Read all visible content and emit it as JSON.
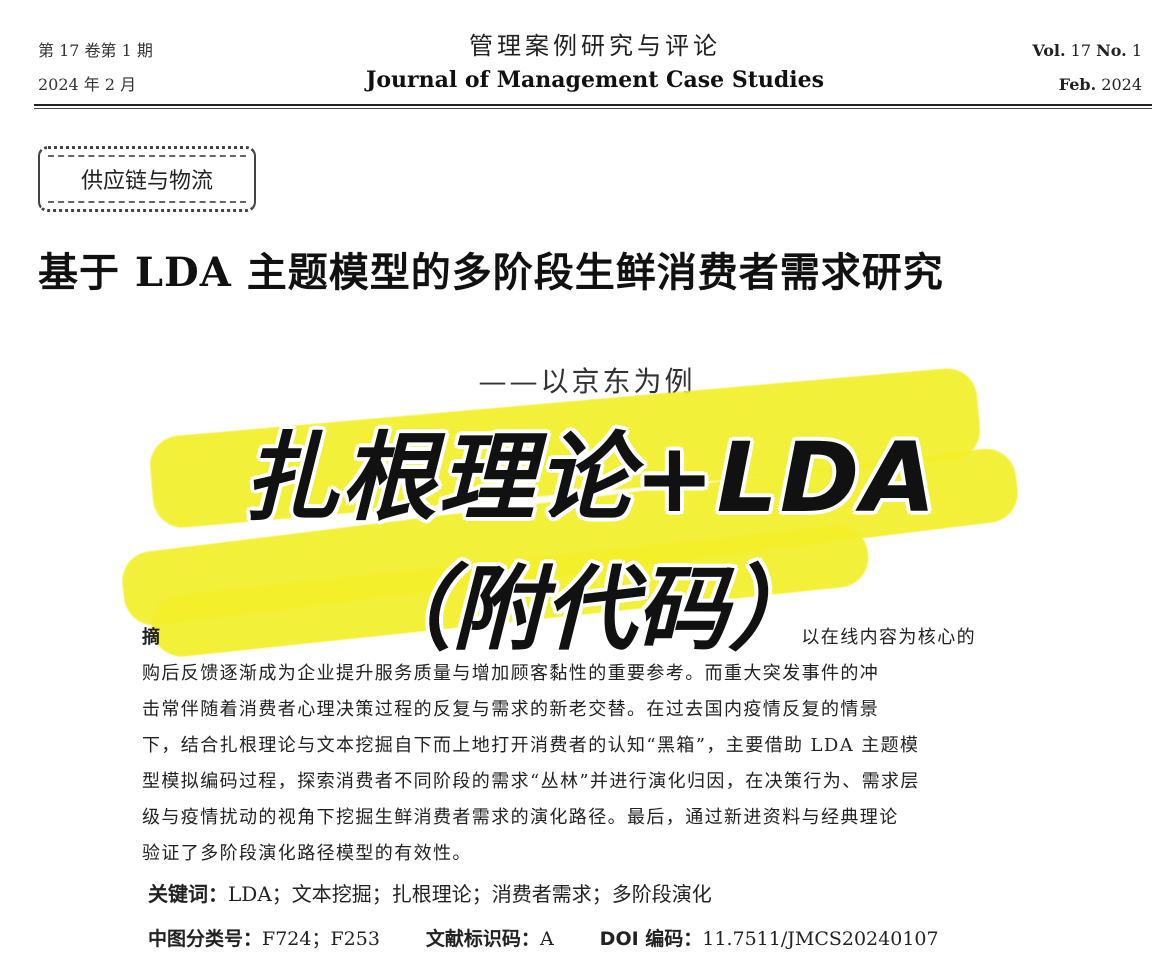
{
  "header": {
    "issue_cn": "第 17 卷第 1 期",
    "date_cn": "2024 年 2 月",
    "journal_cn": "管理案例研究与评论",
    "journal_en": "Journal of Management Case Studies",
    "vol_label": "Vol.",
    "vol_text": "17",
    "no_label": "No.",
    "no_text": "1",
    "month_label": "Feb.",
    "year_text": "2024"
  },
  "column_badge": "供应链与物流",
  "title": "基于 LDA 主题模型的多阶段生鲜消费者需求研究",
  "subtitle": "——以京东为例",
  "overlay": {
    "line1": "扎根理论+LDA",
    "line2": "（附代码）"
  },
  "highlight_color": "#f3ef2a",
  "abstract": {
    "label": "摘",
    "lines": [
      "以在线内容为核心的",
      "购后反馈逐渐成为企业提升服务质量与增加顾客黏性的重要参考。而重大突发事件的冲",
      "击常伴随着消费者心理决策过程的反复与需求的新老交替。在过去国内疫情反复的情景",
      "下，结合扎根理论与文本挖掘自下而上地打开消费者的认知“黑箱”，主要借助 LDA 主题模",
      "型模拟编码过程，探索消费者不同阶段的需求“丛林”并进行演化归因，在决策行为、需求层",
      "级与疫情扰动的视角下挖掘生鲜消费者需求的演化路径。最后，通过新进资料与经典理论",
      "验证了多阶段演化路径模型的有效性。"
    ]
  },
  "keywords": {
    "label": "关键词：",
    "text": "LDA；文本挖掘；扎根理论；消费者需求；多阶段演化"
  },
  "classification": {
    "clc_label": "中图分类号：",
    "clc_value": "F724；F253",
    "doc_label": "文献标识码：",
    "doc_value": "A",
    "doi_label": "DOI 编码：",
    "doi_value": "11.7511/JMCS20240107"
  }
}
